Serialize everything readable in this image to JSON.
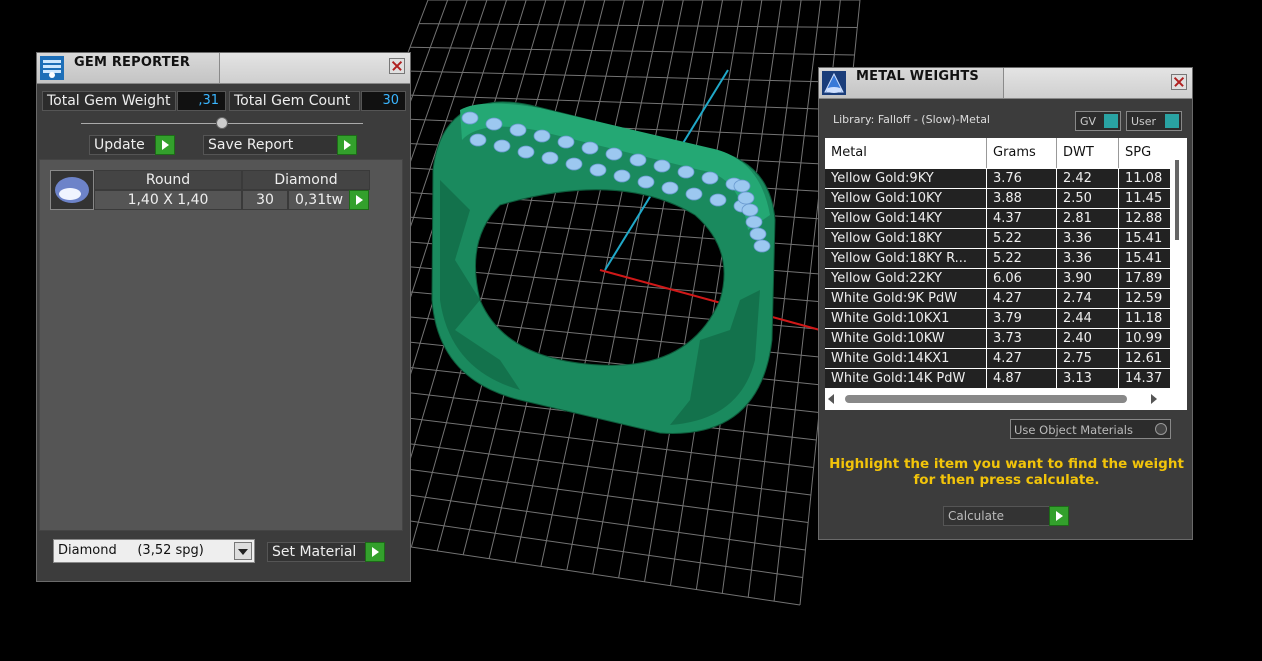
{
  "gem_reporter": {
    "title": "GEM REPORTER",
    "total_weight_label": "Total Gem Weight",
    "total_weight_value": ",31",
    "total_count_label": "Total Gem Count",
    "total_count_value": "30",
    "update_label": "Update",
    "save_report_label": "Save Report",
    "gem": {
      "shape": "Round",
      "type": "Diamond",
      "size": "1,40 X 1,40",
      "count": "30",
      "weight": "0,31tw"
    },
    "material_select": "Diamond     (3,52 spg)",
    "set_material_label": "Set Material",
    "icon": "gem-reporter-icon"
  },
  "metal_weights": {
    "title": "METAL WEIGHTS",
    "library_label": "Library: Falloff - (Slow)-Metal",
    "gv_label": "GV",
    "user_label": "User",
    "columns": [
      "Metal",
      "Grams",
      "DWT",
      "SPG"
    ],
    "rows": [
      [
        "Yellow Gold:9KY",
        "3.76",
        "2.42",
        "11.08"
      ],
      [
        "Yellow Gold:10KY",
        "3.88",
        "2.50",
        "11.45"
      ],
      [
        "Yellow Gold:14KY",
        "4.37",
        "2.81",
        "12.88"
      ],
      [
        "Yellow Gold:18KY",
        "5.22",
        "3.36",
        "15.41"
      ],
      [
        "Yellow Gold:18KY R...",
        "5.22",
        "3.36",
        "15.41"
      ],
      [
        "Yellow Gold:22KY",
        "6.06",
        "3.90",
        "17.89"
      ],
      [
        "White Gold:9K PdW",
        "4.27",
        "2.74",
        "12.59"
      ],
      [
        "White Gold:10KX1",
        "3.79",
        "2.44",
        "11.18"
      ],
      [
        "White Gold:10KW",
        "3.73",
        "2.40",
        "10.99"
      ],
      [
        "White Gold:14KX1",
        "4.27",
        "2.75",
        "12.61"
      ],
      [
        "White Gold:14K PdW",
        "4.87",
        "3.13",
        "14.37"
      ]
    ],
    "use_object_materials_label": "Use Object Materials",
    "instruction_line1": "Highlight the item you want to find the weight",
    "instruction_line2": "for then press calculate.",
    "calculate_label": "Calculate"
  },
  "colors": {
    "ring": "#1f9a6a",
    "gems": "#9cc8f0",
    "axis_x": "#d01818",
    "axis_y": "#20a8c8",
    "accent_yellow": "#f2c40a",
    "button_green": "#33a02c"
  }
}
